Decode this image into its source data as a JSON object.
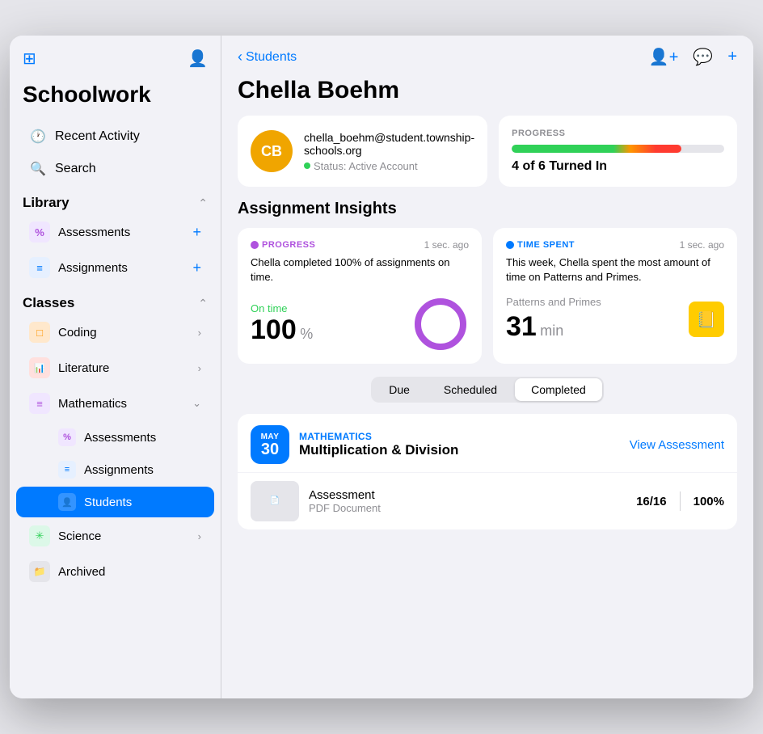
{
  "sidebar": {
    "app_title": "Schoolwork",
    "nav_items": [
      {
        "label": "Recent Activity",
        "icon": "🕐"
      },
      {
        "label": "Search",
        "icon": "🔍"
      }
    ],
    "library": {
      "title": "Library",
      "items": [
        {
          "label": "Assessments",
          "icon": "%",
          "icon_color": "#af52de",
          "has_plus": true
        },
        {
          "label": "Assignments",
          "icon": "≡",
          "icon_color": "#007aff",
          "has_plus": true
        }
      ]
    },
    "classes": {
      "title": "Classes",
      "items": [
        {
          "label": "Coding",
          "icon": "□",
          "icon_color": "#ff9500",
          "has_chevron": true
        },
        {
          "label": "Literature",
          "icon": "📊",
          "icon_color": "#ff3b30",
          "has_chevron": true
        },
        {
          "label": "Mathematics",
          "icon": "≡",
          "icon_color": "#af52de",
          "has_chevron": true,
          "expanded": true,
          "sub_items": [
            {
              "label": "Assessments",
              "icon": "%",
              "icon_color": "#af52de"
            },
            {
              "label": "Assignments",
              "icon": "≡",
              "icon_color": "#007aff"
            },
            {
              "label": "Students",
              "icon": "👤",
              "icon_color": "#007aff",
              "active": true
            }
          ]
        },
        {
          "label": "Science",
          "icon": "✳",
          "icon_color": "#30d158",
          "has_chevron": true
        }
      ]
    },
    "archived": {
      "label": "Archived",
      "icon": "📁",
      "icon_color": "#8e8e93"
    }
  },
  "header": {
    "back_label": "Students",
    "student_name": "Chella Boehm",
    "actions": [
      "person-add-icon",
      "message-icon",
      "add-icon"
    ]
  },
  "student_card": {
    "avatar_initials": "CB",
    "avatar_color": "#f0a500",
    "email": "chella_boehm@student.township-schools.org",
    "status_label": "Status: Active Account"
  },
  "progress_card": {
    "label": "PROGRESS",
    "bar_percent": 80,
    "summary": "4 of 6 Turned In"
  },
  "assignment_insights": {
    "title": "Assignment Insights",
    "progress_card": {
      "badge": "PROGRESS",
      "timestamp": "1 sec. ago",
      "description": "Chella completed 100% of assignments on time.",
      "stat_label": "On time",
      "stat_value": "100",
      "stat_unit": "%"
    },
    "time_card": {
      "badge": "TIME SPENT",
      "timestamp": "1 sec. ago",
      "description": "This week, Chella spent the most amount of time on Patterns and Primes.",
      "subject": "Patterns and Primes",
      "time_value": "31",
      "time_unit": "min"
    }
  },
  "tabs": {
    "items": [
      "Due",
      "Scheduled",
      "Completed"
    ],
    "active": "Completed"
  },
  "assignment": {
    "date_month": "MAY",
    "date_day": "30",
    "subject": "MATHEMATICS",
    "name": "Multiplication & Division",
    "view_button_label": "View Assessment",
    "item_name": "Assessment",
    "item_type": "PDF Document",
    "item_score": "16/16",
    "item_percent": "100%"
  }
}
